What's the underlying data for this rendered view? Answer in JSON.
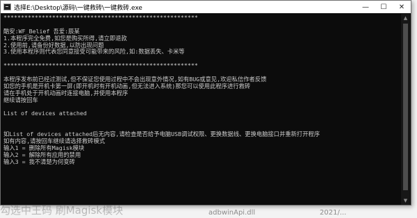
{
  "background": {
    "left_text": "勾选中王码 刷Magisk模块",
    "middle_text": "adbwinApi.dll",
    "right_text": "2021/..."
  },
  "window": {
    "title": "选择E:\\Desktop\\源码\\一键救砖\\一键救砖.exe",
    "minimize_glyph": "—",
    "maximize_glyph": "☐",
    "close_glyph": "✕"
  },
  "console": {
    "lines": [
      "********************************************************",
      "",
      "酷安:WF_Belief 吾爱:辰某",
      "1.本程序完全免费,如您是购买所得,请立即退款",
      "2.使用前,请备份好数据,以防出现问题",
      "3.使用本程序则代表您同意接受可能带来的风险,如:数据丢失、卡米等",
      "",
      "********************************************************",
      "",
      "本程序发布前已经过测试,但不保证您使用过程中不会出现意外情况,如有BUG或意见,欢迎私信作者反馈",
      "如您的手机是开机卡第一屏(即开机时有开机动画,但无法进入系统)那您可以使用此程序进行救砖",
      "请在手机处于开机动画时连接电脑,并使用本程序",
      "继续请按回车",
      "",
      "List of devices attached",
      "",
      "",
      "如List of devices attached后无内容,请检查是否给予电脑USB调试权限、更换数据线、更换电脑接口并重新打开程序",
      "如有内容,请按回车继续请选择救砖模式",
      "输入1 = 删除所有Magisk模块",
      "输入2 = 解除所有应用的禁用",
      "输入3 = 我不清楚为何变砖"
    ]
  }
}
